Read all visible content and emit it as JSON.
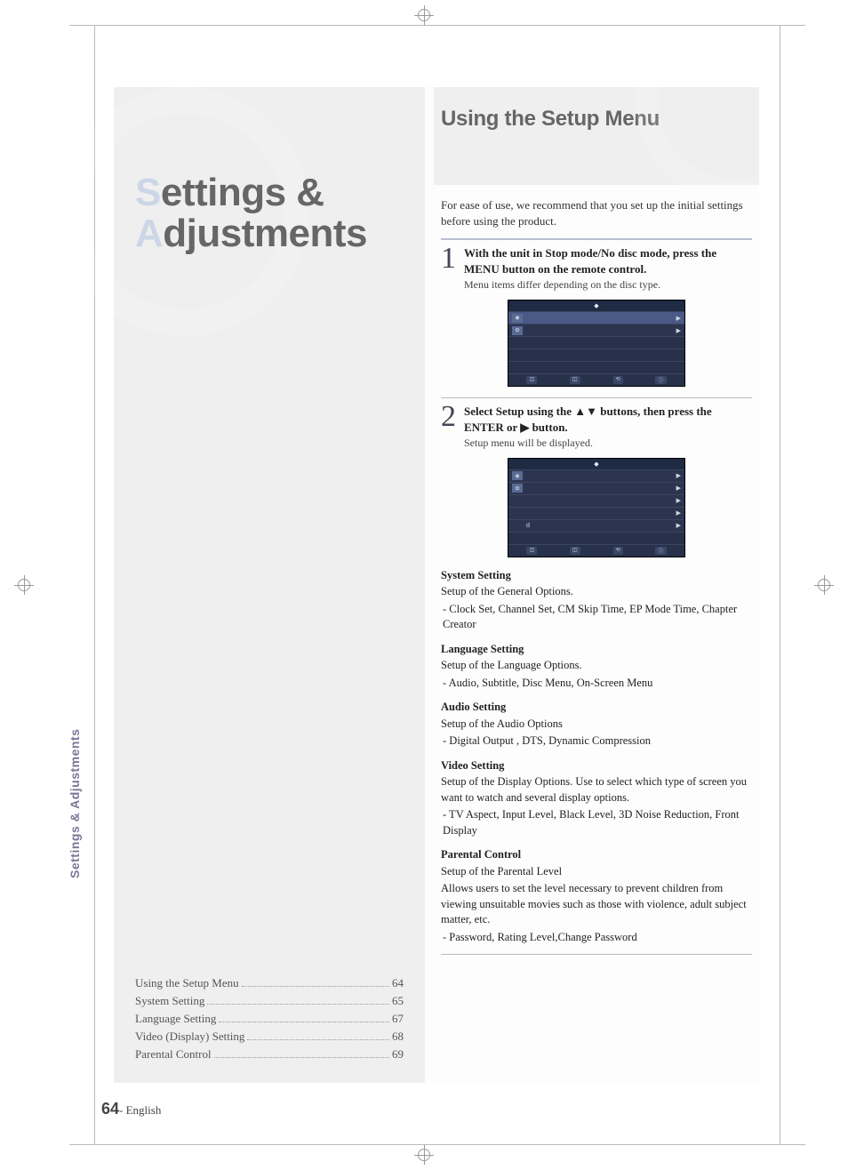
{
  "chapter_title_line1_initial": "S",
  "chapter_title_line1_rest": "ettings &",
  "chapter_title_line2_initial": "A",
  "chapter_title_line2_rest": "djustments",
  "sidebar_tab": "Settings & Adjustments",
  "toc": [
    {
      "label": "Using the Setup Menu",
      "page": "64"
    },
    {
      "label": "System Setting",
      "page": "65"
    },
    {
      "label": "Language Setting",
      "page": "67"
    },
    {
      "label": "Video (Display) Setting",
      "page": "68"
    },
    {
      "label": "Parental Control",
      "page": "69"
    }
  ],
  "right_heading": "Using the Setup Menu",
  "intro": "For ease of use, we recommend that you set up the initial settings before using the product.",
  "steps": [
    {
      "num": "1",
      "main": "With the unit in Stop mode/No disc mode, press the MENU button on the remote control.",
      "sub": "Menu items differ depending on the disc type."
    },
    {
      "num": "2",
      "main": "Select Setup using the ▲▼ buttons, then press the ENTER or ▶ button.",
      "sub": "Setup menu will be displayed."
    }
  ],
  "osd": {
    "title": "◆",
    "rows1": [
      {
        "icon": "◉",
        "label": "",
        "arrow": "▶"
      },
      {
        "icon": "✿",
        "label": "",
        "arrow": "▶"
      }
    ],
    "rows2": [
      {
        "icon": "◉",
        "label": "",
        "arrow": "▶"
      },
      {
        "icon": "✿",
        "label": "",
        "arrow": "▶"
      },
      {
        "icon": "",
        "label": "",
        "arrow": "▶"
      },
      {
        "icon": "",
        "label": "",
        "arrow": "▶"
      },
      {
        "icon": "",
        "label": "d",
        "arrow": "▶"
      }
    ],
    "footer": [
      "◫",
      "◫",
      "⟲",
      "ⓘ"
    ]
  },
  "sections": [
    {
      "title": "System Setting",
      "sub": "Setup of the General Options.",
      "items": "- Clock Set, Channel Set, CM Skip Time, EP Mode Time, Chapter Creator"
    },
    {
      "title": "Language Setting",
      "sub": "Setup of the Language Options.",
      "items": "- Audio, Subtitle, Disc Menu, On-Screen Menu"
    },
    {
      "title": "Audio Setting",
      "sub": "Setup of the Audio Options",
      "items": "- Digital Output , DTS, Dynamic Compression"
    },
    {
      "title": "Video Setting",
      "sub": "Setup of the Display Options. Use to select which type of screen you want to watch and several display options.",
      "items": "- TV Aspect, Input Level, Black Level, 3D Noise Reduction, Front Display"
    },
    {
      "title": "Parental Control",
      "sub": "Setup of the Parental Level",
      "extra": "Allows users to set the level necessary to prevent children from viewing unsuitable movies such as those with violence, adult subject matter, etc.",
      "items": "- Password, Rating Level,Change Password"
    }
  ],
  "page_number": "64",
  "page_lang": "- English"
}
